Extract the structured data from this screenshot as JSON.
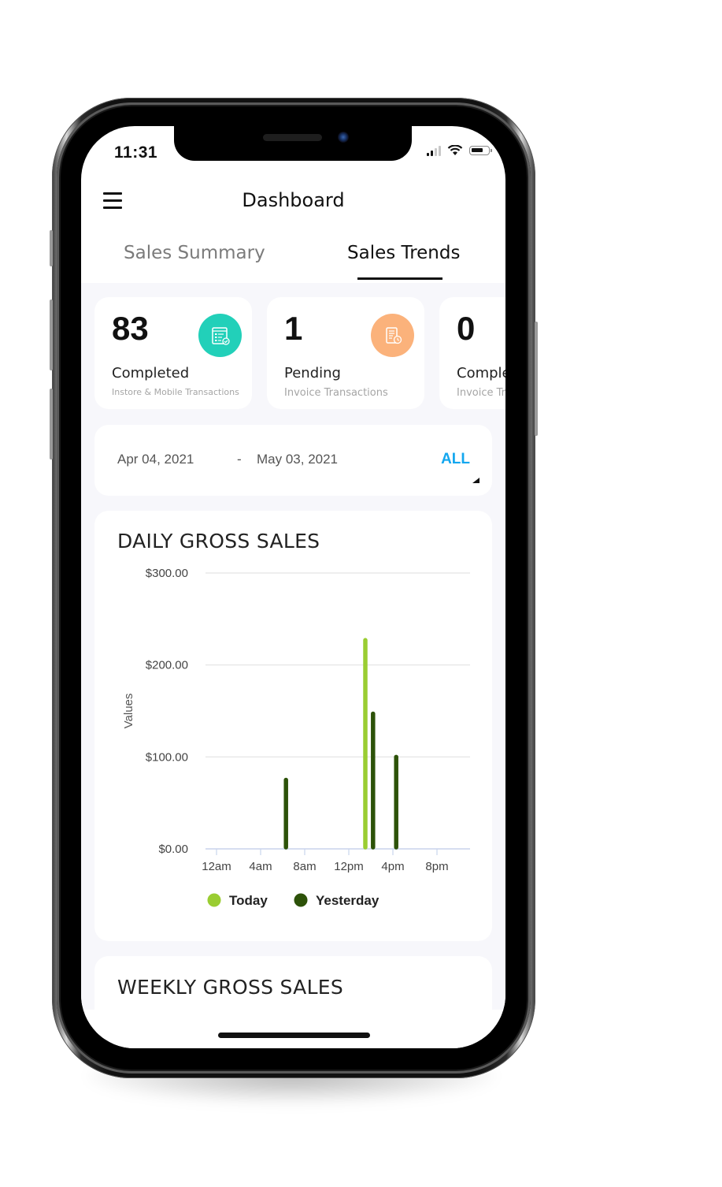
{
  "status_bar": {
    "time": "11:31",
    "icons": [
      "cellular-signal-icon",
      "wifi-icon",
      "battery-icon"
    ]
  },
  "header": {
    "title": "Dashboard",
    "menu_icon": "hamburger-menu-icon"
  },
  "tabs": [
    {
      "label": "Sales Summary",
      "active": false
    },
    {
      "label": "Sales Trends",
      "active": true
    }
  ],
  "stat_cards": [
    {
      "value": "83",
      "label": "Completed",
      "sublabel": "Instore & Mobile Transactions",
      "icon": "checklist-document-icon",
      "icon_color": "#22d0b9"
    },
    {
      "value": "1",
      "label": "Pending",
      "sublabel": "Invoice Transactions",
      "icon": "invoice-clock-icon",
      "icon_color": "#fbb27b"
    },
    {
      "value": "0",
      "label": "Completed",
      "sublabel": "Invoice Transactions",
      "icon": "",
      "icon_color": ""
    }
  ],
  "date_range": {
    "from": "Apr 04, 2021",
    "separator": "-",
    "to": "May 03, 2021",
    "filter_label": "ALL",
    "filter_color": "#13a7ef"
  },
  "daily_chart": {
    "title": "DAILY GROSS SALES"
  },
  "weekly_chart": {
    "title": "WEEKLY GROSS SALES"
  },
  "chart_data": {
    "type": "bar",
    "title": "DAILY GROSS SALES",
    "xlabel": "",
    "ylabel": "Values",
    "x_unit": "hour",
    "xlim": [
      0,
      24
    ],
    "x_ticks": [
      0,
      4,
      8,
      12,
      16,
      20
    ],
    "x_tick_labels": [
      "12am",
      "4am",
      "8am",
      "12pm",
      "4pm",
      "8pm"
    ],
    "ylim": [
      0,
      300
    ],
    "y_ticks": [
      0,
      100,
      200,
      300
    ],
    "y_tick_labels": [
      "$0.00",
      "$100.00",
      "$200.00",
      "$300.00"
    ],
    "grid": true,
    "legend_position": "bottom-center",
    "series": [
      {
        "name": "Today",
        "color": "#9acd32",
        "points": [
          {
            "hour": 13.5,
            "value": 227
          }
        ]
      },
      {
        "name": "Yesterday",
        "color": "#2d5209",
        "points": [
          {
            "hour": 6.3,
            "value": 75
          },
          {
            "hour": 14.2,
            "value": 147
          },
          {
            "hour": 16.3,
            "value": 100
          }
        ]
      }
    ]
  }
}
